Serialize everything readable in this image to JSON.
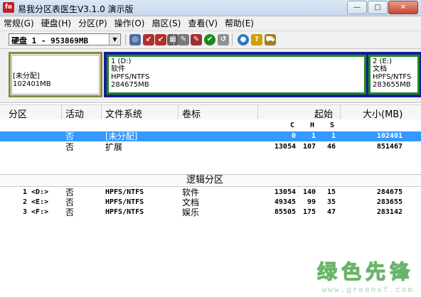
{
  "window": {
    "title": "易我分区表医生V3.1.0 演示版",
    "app_icon_text": "fa",
    "buttons": {
      "minimize": "—",
      "maximize": "□",
      "close": "✕"
    }
  },
  "menu": [
    {
      "label": "常规(G)"
    },
    {
      "label": "硬盘(H)"
    },
    {
      "label": "分区(P)"
    },
    {
      "label": "操作(O)"
    },
    {
      "label": "扇区(S)"
    },
    {
      "label": "查看(V)"
    },
    {
      "label": "帮助(E)"
    }
  ],
  "toolbar": {
    "disk_select_value": "硬盘 1 - 953869MB",
    "dropdown_arrow": "▼",
    "icons": [
      {
        "name": "search-partition-icon",
        "glyph": "◎",
        "color": "#4a6fa5"
      },
      {
        "name": "write-icon",
        "glyph": "↙",
        "color": "#b03030"
      },
      {
        "name": "write2-icon",
        "glyph": "↙",
        "color": "#b03030"
      },
      {
        "name": "sector-icon",
        "glyph": "▦",
        "color": "#606060"
      },
      {
        "name": "tool-icon",
        "glyph": "✎",
        "color": "#7a7a7a"
      },
      {
        "name": "tool2-icon",
        "glyph": "✎",
        "color": "#a03030"
      },
      {
        "name": "ok-icon",
        "glyph": "✔",
        "color": "#1a8a1a"
      },
      {
        "name": "undo-icon",
        "glyph": "↺",
        "color": "#909090"
      },
      {
        "name": "globe-icon",
        "glyph": "●",
        "color": "#2a7ac0"
      },
      {
        "name": "help-icon",
        "glyph": "?",
        "color": "#d0a000"
      },
      {
        "name": "cart-icon",
        "glyph": "⛟",
        "color": "#a08020"
      }
    ]
  },
  "map": {
    "unallocated": {
      "label": "[未分配]",
      "size": "102401MB"
    },
    "partitions": [
      {
        "number": "1 (D:)",
        "name": "软件",
        "fs": "HPFS/NTFS",
        "size": "284675MB"
      },
      {
        "number": "2 (E:)",
        "name": "文档",
        "fs": "HPFS/NTFS",
        "size": "283655MB"
      }
    ]
  },
  "table": {
    "headers": {
      "partition": "分区",
      "active": "活动",
      "fs": "文件系统",
      "label": "卷标",
      "start": "起始",
      "size": "大小(MB)"
    },
    "chs": {
      "c": "C",
      "h": "H",
      "s": "S"
    },
    "primary_rows": [
      {
        "part": "",
        "active": "否",
        "fs": "[未分配]",
        "label": "",
        "c": "0",
        "h": "1",
        "s": "1",
        "size": "102401",
        "selected": true
      },
      {
        "part": "",
        "active": "否",
        "fs": "扩展",
        "label": "",
        "c": "13054",
        "h": "107",
        "s": "46",
        "size": "851467",
        "selected": false
      }
    ],
    "logical_section": "逻辑分区",
    "logical_rows": [
      {
        "part": "1 <D:>",
        "active": "否",
        "fs": "HPFS/NTFS",
        "label": "软件",
        "c": "13054",
        "h": "140",
        "s": "15",
        "size": "284675"
      },
      {
        "part": "2 <E:>",
        "active": "否",
        "fs": "HPFS/NTFS",
        "label": "文档",
        "c": "49345",
        "h": "99",
        "s": "35",
        "size": "283655"
      },
      {
        "part": "3 <F:>",
        "active": "否",
        "fs": "HPFS/NTFS",
        "label": "娱乐",
        "c": "85505",
        "h": "175",
        "s": "47",
        "size": "283142"
      }
    ]
  },
  "watermark": {
    "logo": "绿色先锋",
    "url": "www.greenxf.com"
  }
}
